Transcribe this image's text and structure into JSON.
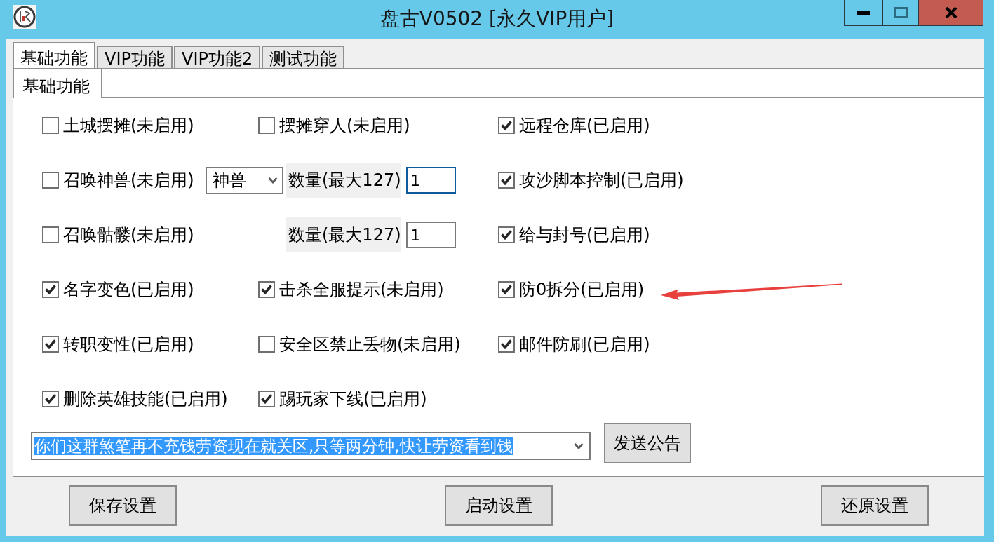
{
  "window": {
    "title": "盘古V0502 [永久VIP用户]"
  },
  "tabs": [
    {
      "label": "基础功能",
      "selected": true
    },
    {
      "label": "VIP功能",
      "selected": false
    },
    {
      "label": "VIP功能2",
      "selected": false
    },
    {
      "label": "测试功能",
      "selected": false
    }
  ],
  "subtabs": [
    {
      "label": "基础功能",
      "selected": true
    }
  ],
  "rows": [
    {
      "cells": [
        {
          "kind": "checkbox",
          "label": "土城摆摊(未启用)",
          "checked": false,
          "annotated": false
        },
        {
          "kind": "checkbox",
          "label": "摆摊穿人(未启用)",
          "checked": false,
          "annotated": false
        },
        {
          "kind": "checkbox",
          "label": "远程仓库(已启用)",
          "checked": true,
          "annotated": false
        }
      ]
    },
    {
      "cells": [
        {
          "kind": "checkbox",
          "label": "召唤神兽(未启用)",
          "checked": false,
          "annotated": false
        },
        {
          "kind": "quantity",
          "select": {
            "value": "神兽"
          },
          "label": "数量(最大127)",
          "value": "1",
          "focused": true
        },
        {
          "kind": "checkbox",
          "label": "攻沙脚本控制(已启用)",
          "checked": true,
          "annotated": false
        }
      ]
    },
    {
      "cells": [
        {
          "kind": "checkbox",
          "label": "召唤骷髅(未启用)",
          "checked": false,
          "annotated": false
        },
        {
          "kind": "quantity",
          "label": "数量(最大127)",
          "value": "1",
          "focused": false
        },
        {
          "kind": "checkbox",
          "label": "给与封号(已启用)",
          "checked": true,
          "annotated": false
        }
      ]
    },
    {
      "cells": [
        {
          "kind": "checkbox",
          "label": "名字变色(已启用)",
          "checked": true,
          "annotated": false
        },
        {
          "kind": "checkbox",
          "label": "击杀全服提示(未启用)",
          "checked": true,
          "annotated": false
        },
        {
          "kind": "checkbox",
          "label": "防0拆分(已启用)",
          "checked": true,
          "annotated": true
        }
      ]
    },
    {
      "cells": [
        {
          "kind": "checkbox",
          "label": "转职变性(已启用)",
          "checked": true,
          "annotated": false
        },
        {
          "kind": "checkbox",
          "label": "安全区禁止丢物(未启用)",
          "checked": false,
          "annotated": false
        },
        {
          "kind": "checkbox",
          "label": "邮件防刷(已启用)",
          "checked": true,
          "annotated": false
        }
      ]
    },
    {
      "cells": [
        {
          "kind": "checkbox",
          "label": "删除英雄技能(已启用)",
          "checked": true,
          "annotated": false
        },
        {
          "kind": "checkbox",
          "label": "踢玩家下线(已启用)",
          "checked": true,
          "annotated": false
        }
      ]
    }
  ],
  "notice": {
    "value": "你们这群煞笔再不充钱劳资现在就关区,只等两分钟,快让劳资看到钱",
    "text_selected": true
  },
  "send_button": "发送公告",
  "buttons": [
    "保存设置",
    "启动设置",
    "还原设置"
  ]
}
